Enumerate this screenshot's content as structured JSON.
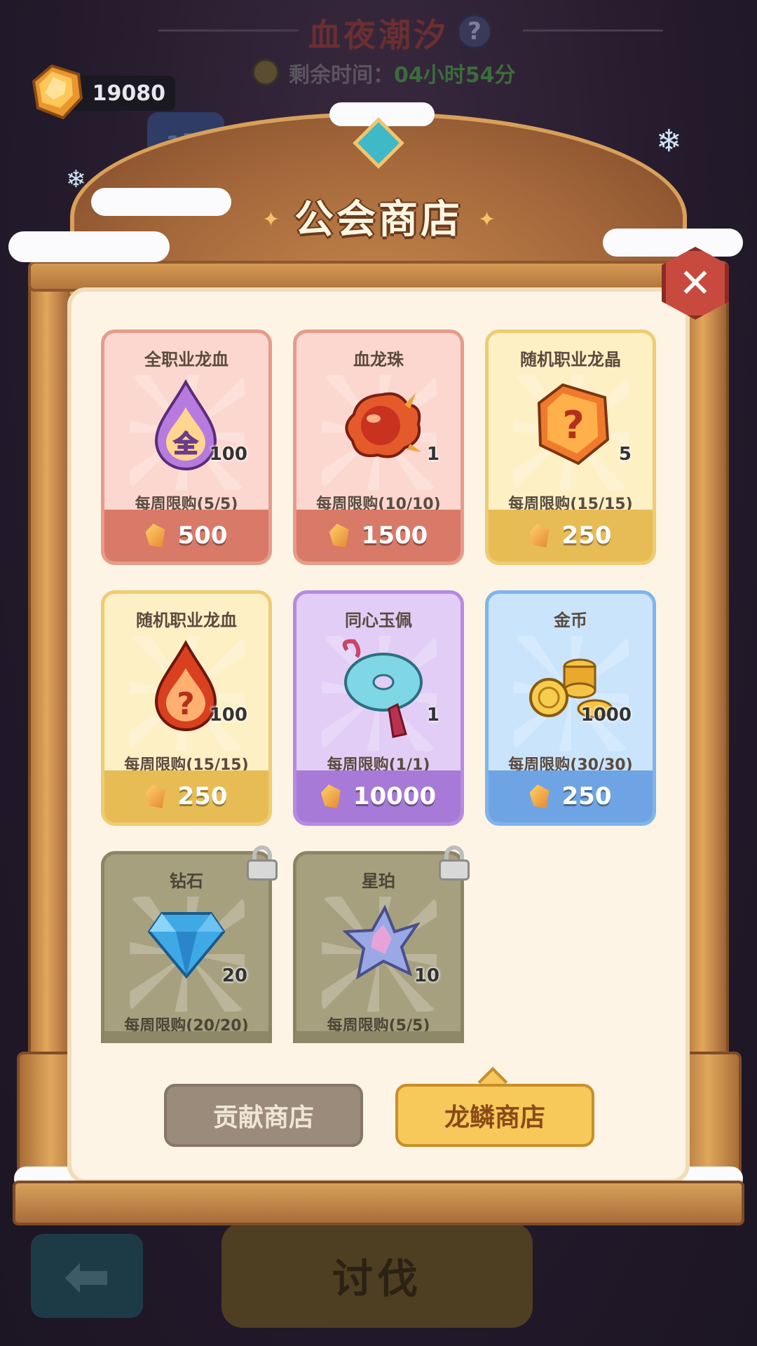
{
  "background": {
    "event_title": "血夜潮汐",
    "help_label": "?",
    "time_label": "剩余时间：",
    "time_value": "04小时54分",
    "currency_amount": "19080",
    "team_label": "1队",
    "attack_label": "讨伐",
    "back_icon": "arrow-left-icon"
  },
  "shop": {
    "title": "公会商店",
    "close_icon": "close-icon",
    "items": [
      {
        "name": "全职业龙血",
        "qty": "100",
        "limit": "每周限购(5/5)",
        "price": "500",
        "theme": "red",
        "icon": "all-class-dragon-blood-icon"
      },
      {
        "name": "血龙珠",
        "qty": "1",
        "limit": "每周限购(10/10)",
        "price": "1500",
        "theme": "red",
        "icon": "blood-dragon-orb-icon"
      },
      {
        "name": "随机职业龙晶",
        "qty": "5",
        "limit": "每周限购(15/15)",
        "price": "250",
        "theme": "gold",
        "icon": "random-dragon-crystal-icon"
      },
      {
        "name": "随机职业龙血",
        "qty": "100",
        "limit": "每周限购(15/15)",
        "price": "250",
        "theme": "gold",
        "icon": "random-dragon-blood-icon"
      },
      {
        "name": "同心玉佩",
        "qty": "1",
        "limit": "每周限购(1/1)",
        "price": "10000",
        "theme": "purple",
        "icon": "jade-pendant-icon"
      },
      {
        "name": "金币",
        "qty": "1000",
        "limit": "每周限购(30/30)",
        "price": "250",
        "theme": "blue",
        "icon": "gold-coin-icon"
      },
      {
        "name": "钻石",
        "qty": "20",
        "limit": "每周限购(20/20)",
        "price": "",
        "theme": "locked",
        "icon": "diamond-icon"
      },
      {
        "name": "星珀",
        "qty": "10",
        "limit": "每周限购(5/5)",
        "price": "",
        "theme": "locked",
        "icon": "star-amber-icon"
      }
    ],
    "tabs": [
      {
        "label": "贡献商店",
        "active": false
      },
      {
        "label": "龙鳞商店",
        "active": true
      }
    ]
  },
  "colors": {
    "frame_wood": "#b87a3e",
    "panel_bg": "#fdf4e6",
    "accent_gold": "#f6c95a",
    "close_red": "#c84a3e"
  }
}
